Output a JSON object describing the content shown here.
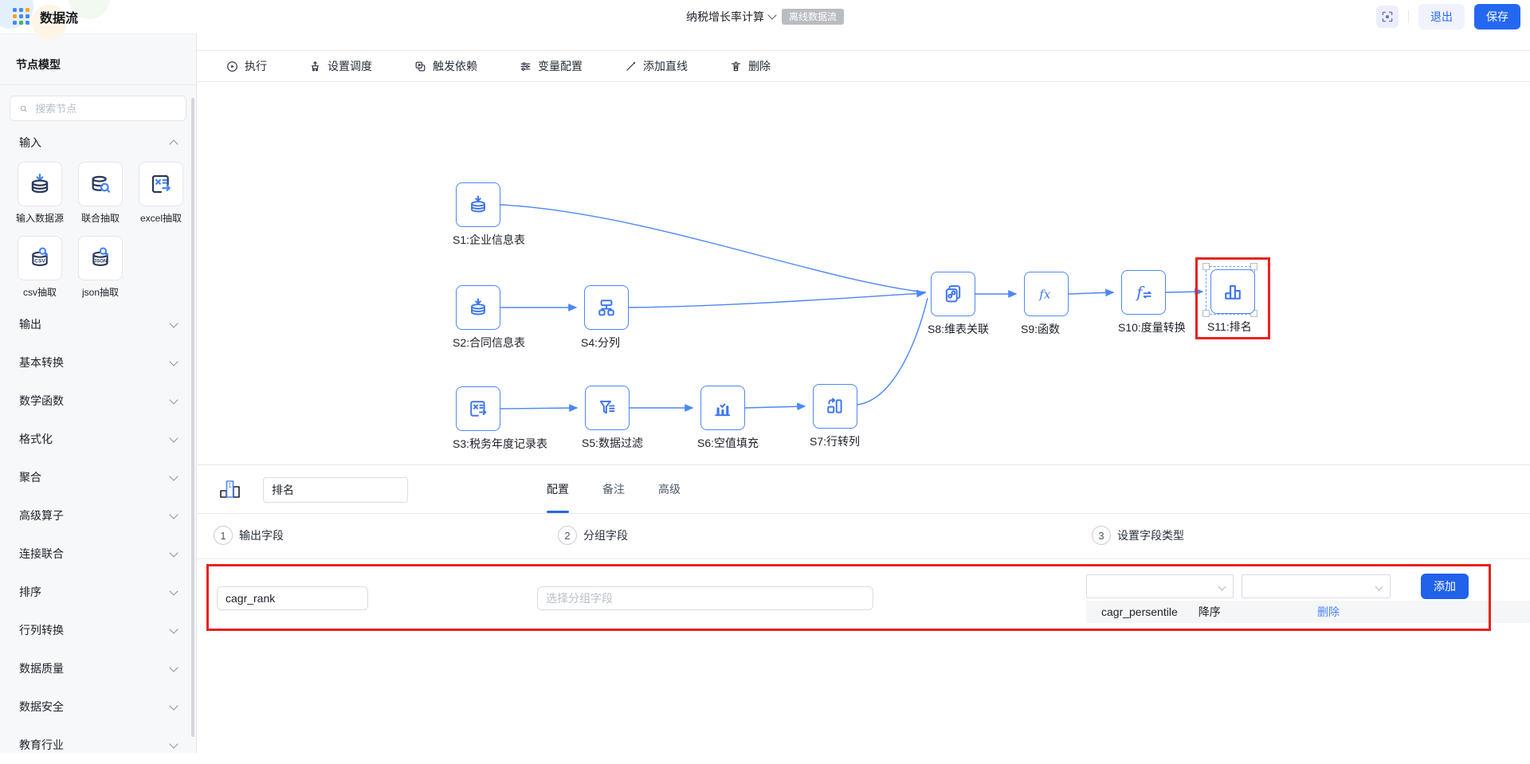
{
  "colors": {
    "accent": "#2468f2",
    "node_blue": "#4a86f8",
    "edge_blue": "#4d87f5",
    "highlight_red": "#e8231d",
    "badge_bg": "#b9bcc2"
  },
  "header": {
    "app_title": "数据流",
    "flow_name": "纳税增长率计算",
    "flow_type_badge": "离线数据流",
    "exit_label": "退出",
    "save_label": "保存"
  },
  "toolbar": {
    "items": [
      {
        "label": "执行",
        "icon": "play-circle-icon"
      },
      {
        "label": "设置调度",
        "icon": "schedule-icon"
      },
      {
        "label": "触发依赖",
        "icon": "trigger-dependency-icon"
      },
      {
        "label": "变量配置",
        "icon": "variable-config-icon"
      },
      {
        "label": "添加直线",
        "icon": "add-line-icon"
      },
      {
        "label": "删除",
        "icon": "trash-icon"
      }
    ]
  },
  "sidebar": {
    "title": "节点模型",
    "search_placeholder": "搜索节点",
    "input_group": {
      "label": "输入",
      "items": [
        {
          "label": "输入数据源",
          "icon": "database-download-icon"
        },
        {
          "label": "联合抽取",
          "icon": "database-search-icon"
        },
        {
          "label": "excel抽取",
          "icon": "excel-extract-icon"
        },
        {
          "label": "csv抽取",
          "icon": "csv-extract-icon"
        },
        {
          "label": "json抽取",
          "icon": "json-extract-icon"
        }
      ]
    },
    "sections": [
      {
        "label": "输出"
      },
      {
        "label": "基本转换"
      },
      {
        "label": "数学函数"
      },
      {
        "label": "格式化"
      },
      {
        "label": "聚合"
      },
      {
        "label": "高级算子"
      },
      {
        "label": "连接联合"
      },
      {
        "label": "排序"
      },
      {
        "label": "行列转换"
      },
      {
        "label": "数据质量"
      },
      {
        "label": "数据安全"
      },
      {
        "label": "教育行业"
      }
    ]
  },
  "canvas": {
    "nodes": [
      {
        "id": "S1",
        "label": "S1:企业信息表",
        "icon": "database-input-icon"
      },
      {
        "id": "S2",
        "label": "S2:合同信息表",
        "icon": "database-input-icon"
      },
      {
        "id": "S3",
        "label": "S3:税务年度记录表",
        "icon": "excel-extract-icon"
      },
      {
        "id": "S4",
        "label": "S4:分列",
        "icon": "split-columns-icon"
      },
      {
        "id": "S5",
        "label": "S5:数据过滤",
        "icon": "filter-icon"
      },
      {
        "id": "S6",
        "label": "S6:空值填充",
        "icon": "fill-null-icon"
      },
      {
        "id": "S7",
        "label": "S7:行转列",
        "icon": "row-to-column-icon"
      },
      {
        "id": "S8",
        "label": "S8:维表关联",
        "icon": "dim-table-join-icon"
      },
      {
        "id": "S9",
        "label": "S9:函数",
        "icon": "function-icon"
      },
      {
        "id": "S10",
        "label": "S10:度量转换",
        "icon": "measure-convert-icon"
      },
      {
        "id": "S11",
        "label": "S11:排名",
        "icon": "rank-icon",
        "selected": true
      }
    ]
  },
  "panel": {
    "node_name_value": "排名",
    "tabs": [
      {
        "label": "配置",
        "active": true
      },
      {
        "label": "备注",
        "active": false
      },
      {
        "label": "高级",
        "active": false
      }
    ],
    "steps": [
      {
        "num": "1",
        "label": "输出字段"
      },
      {
        "num": "2",
        "label": "分组字段"
      },
      {
        "num": "3",
        "label": "设置字段类型"
      }
    ],
    "output_field_value": "cagr_rank",
    "group_field_placeholder": "选择分组字段",
    "add_label": "添加",
    "sort_rows": [
      {
        "field": "cagr_persentile",
        "order": "降序",
        "delete_label": "删除"
      }
    ]
  }
}
